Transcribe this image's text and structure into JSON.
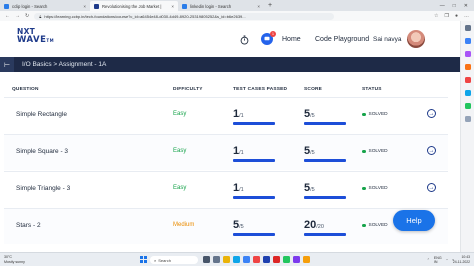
{
  "browser": {
    "tabs": [
      {
        "label": "cclip login - Search",
        "color": "#2b7de9"
      },
      {
        "label": "Revolutionising the Job Market |",
        "color": "#1e3a8a"
      },
      {
        "label": "linkedin login - Search",
        "color": "#2b7de9"
      }
    ],
    "new_tab": "+",
    "url": "https://learning.ccbp.in/tech-foundations/course?c_id=a6454e48-d030-4d49-8920-25319805252&s_id=b6e2639..."
  },
  "header": {
    "logo_line1": "NXT",
    "logo_line2": "WAVE",
    "logo_tm": "TM",
    "notification_count": "1",
    "nav_home": "Home",
    "nav_code_playground": "Code Playground",
    "user_name": "Sai navya"
  },
  "breadcrumb": {
    "text": "I/O Basics > Assignment - 1A"
  },
  "table": {
    "headers": {
      "question": "QUESTION",
      "difficulty": "DIFFICULTY",
      "tests": "TEST CASES PASSED",
      "score": "SCORE",
      "status": "STATUS"
    },
    "rows": [
      {
        "name": "Simple Rectangle",
        "difficulty": "Easy",
        "passed": "1",
        "total": "/1",
        "score": "5",
        "score_total": "/5",
        "status": "SOLVED",
        "progress": 1.0
      },
      {
        "name": "Simple Square - 3",
        "difficulty": "Easy",
        "passed": "1",
        "total": "/1",
        "score": "5",
        "score_total": "/5",
        "status": "SOLVED",
        "progress": 1.0
      },
      {
        "name": "Simple Triangle - 3",
        "difficulty": "Easy",
        "passed": "1",
        "total": "/1",
        "score": "5",
        "score_total": "/5",
        "status": "SOLVED",
        "progress": 1.0
      },
      {
        "name": "Stars - 2",
        "difficulty": "Medium",
        "passed": "5",
        "total": "/5",
        "score": "20",
        "score_total": "/20",
        "status": "SOLVED",
        "progress": 1.0
      }
    ]
  },
  "help_label": "Help",
  "taskbar": {
    "weather_temp": "30°C",
    "weather_desc": "Mostly sunny",
    "search_label": "Search",
    "language": "ENG\nIN",
    "time": "10:43",
    "date": "24-11-2022"
  },
  "colors": {
    "brand_dark": "#1e2a47",
    "accent": "#1d4ed8",
    "easy": "#16a34a",
    "medium": "#ea8c00"
  }
}
